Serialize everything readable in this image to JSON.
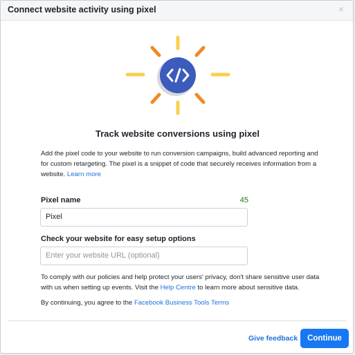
{
  "dialog": {
    "title": "Connect website activity using pixel",
    "close_icon": "×"
  },
  "illustration": {
    "icon": "code-icon",
    "colors": {
      "circle": "#3b5bbd",
      "rays_yellow": "#f7d050",
      "rays_orange": "#f08a24"
    }
  },
  "intro": {
    "headline": "Track website conversions using pixel",
    "description": "Add the pixel code to your website to run conversion campaigns, build advanced reporting and for custom retargeting. The pixel is a snippet of code that securely receives information from a website.",
    "learn_more": "Learn more"
  },
  "form": {
    "pixel_name_label": "Pixel name",
    "pixel_name_counter": "45",
    "pixel_name_value": "Pixel",
    "website_label": "Check your website for easy setup options",
    "website_placeholder": "Enter your website URL (optional)"
  },
  "policy": {
    "text_before": "To comply with our policies and help protect your users' privacy, don't share sensitive user data with us when setting up events. Visit the ",
    "help_link": "Help Centre",
    "text_after": " to learn more about sensitive data."
  },
  "terms": {
    "text": "By continuing, you agree to the ",
    "link": "Facebook Business Tools Terms"
  },
  "footer": {
    "feedback": "Give feedback",
    "continue": "Continue"
  },
  "colors": {
    "accent": "#1877f2",
    "link": "#216fdb",
    "counter": "#1b7b07"
  }
}
